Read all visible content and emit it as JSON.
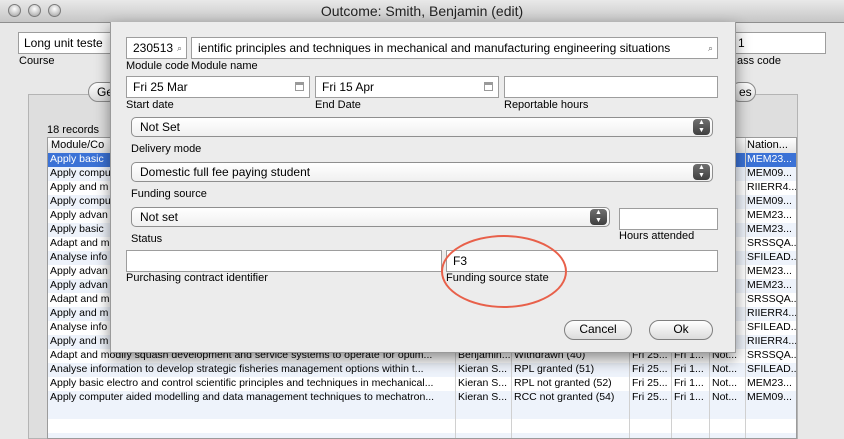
{
  "window": {
    "title": "Outcome: Smith, Benjamin (edit)"
  },
  "background": {
    "course_value": "Long unit teste",
    "course_label": "Course",
    "right_field_value": "1",
    "class_code_label": "ass code",
    "tab_left": "Ge",
    "tab_right": "es",
    "records_label": "18 records",
    "grid_headers": [
      "Module/Co",
      "Nation..."
    ],
    "hidden_rows": [
      {
        "text": "Apply basic",
        "code": "MEM23..."
      },
      {
        "text": "Apply compu",
        "code": "MEM09..."
      },
      {
        "text": "Apply and m",
        "code": "RIIERR4..."
      },
      {
        "text": "Apply compu",
        "code": "MEM09..."
      },
      {
        "text": "Apply advan",
        "code": "MEM23..."
      },
      {
        "text": "Apply basic",
        "code": "MEM23..."
      },
      {
        "text": "Adapt and m",
        "code": "SRSSQA..."
      },
      {
        "text": "Analyse info",
        "code": "SFILEAD..."
      },
      {
        "text": "Apply advan",
        "code": "MEM23..."
      },
      {
        "text": "Apply advan",
        "code": "MEM23..."
      },
      {
        "text": "Adapt and m",
        "code": "SRSSQA..."
      },
      {
        "text": "Apply and m",
        "code": "RIIERR4..."
      },
      {
        "text": "Analyse info",
        "code": "SFILEAD..."
      },
      {
        "text": "Apply and m",
        "code": "RIIERR4..."
      }
    ],
    "visible_rows": [
      {
        "module": "Adapt and modify squash development and service systems to operate for optim...",
        "student": "Benjamin...",
        "status": "Withdrawn (40)",
        "start": "Fri 25...",
        "end": "Fri 1...",
        "hours": "Not...",
        "code": "SRSSQA..."
      },
      {
        "module": "Analyse information to develop strategic fisheries management options within t...",
        "student": "Kieran S...",
        "status": "RPL granted (51)",
        "start": "Fri 25...",
        "end": "Fri 1...",
        "hours": "Not...",
        "code": "SFILEAD..."
      },
      {
        "module": "Apply basic electro and control scientific principles and techniques in mechanical...",
        "student": "Kieran S...",
        "status": "RPL not granted (52)",
        "start": "Fri 25...",
        "end": "Fri 1...",
        "hours": "Not...",
        "code": "MEM23..."
      },
      {
        "module": "Apply computer aided modelling and data management techniques to mechatron...",
        "student": "Kieran S...",
        "status": "RCC not granted (54)",
        "start": "Fri 25...",
        "end": "Fri 1...",
        "hours": "Not...",
        "code": "MEM09..."
      }
    ]
  },
  "dialog": {
    "module_code": "230513",
    "module_name": "ientific principles and techniques in mechanical and manufacturing engineering situations",
    "module_code_label": "Module code",
    "module_name_label": "Module name",
    "start_date": "Fri 25 Mar",
    "end_date": "Fri 15 Apr",
    "reportable_hours": "",
    "start_date_label": "Start date",
    "end_date_label": "End Date",
    "reportable_hours_label": "Reportable hours",
    "delivery_mode": "Not Set",
    "delivery_mode_label": "Delivery mode",
    "funding_source": "Domestic full fee paying student",
    "funding_source_label": "Funding source",
    "status": "Not set",
    "status_label": "Status",
    "hours_attended": "",
    "hours_attended_label": "Hours attended",
    "purchasing_contract": "",
    "purchasing_contract_label": "Purchasing contract identifier",
    "funding_source_state": "F3",
    "funding_source_state_label": "Funding source state",
    "cancel_label": "Cancel",
    "ok_label": "Ok"
  },
  "colors": {
    "selection": "#3b72d6",
    "annotation": "#e8604a"
  }
}
